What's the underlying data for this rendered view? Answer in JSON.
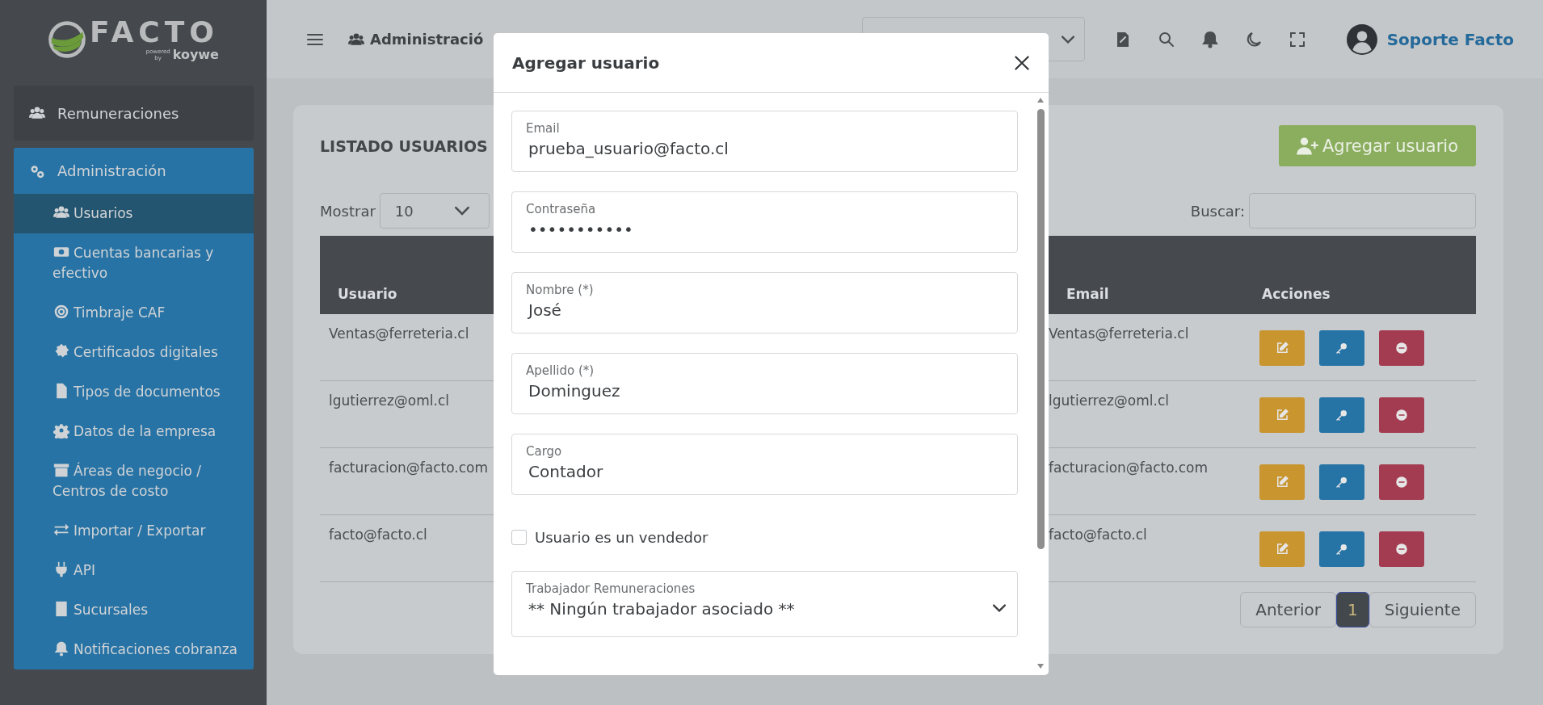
{
  "sidebar": {
    "logo": {
      "name": "FACTO",
      "tagline": "powered",
      "by": "by",
      "brand": "koywe"
    },
    "sections": [
      {
        "label": "Remuneraciones",
        "expanded": false
      },
      {
        "label": "Administración",
        "expanded": true,
        "children": [
          {
            "label": "Usuarios",
            "selected": true
          },
          {
            "label": "Cuentas bancarias y efectivo",
            "selected": false
          },
          {
            "label": "Timbraje CAF",
            "selected": false
          },
          {
            "label": "Certificados digitales",
            "selected": false
          },
          {
            "label": "Tipos de documentos",
            "selected": false
          },
          {
            "label": "Datos de la empresa",
            "selected": false
          },
          {
            "label": "Áreas de negocio / Centros de costo",
            "selected": false
          },
          {
            "label": "Importar / Exportar",
            "selected": false
          },
          {
            "label": "API",
            "selected": false
          },
          {
            "label": "Sucursales",
            "selected": false
          },
          {
            "label": "Notificaciones cobranza",
            "selected": false
          }
        ]
      }
    ]
  },
  "header": {
    "section": "Administració",
    "user": "Soporte Facto"
  },
  "page": {
    "title": "LISTADO USUARIOS",
    "add_button": "Agregar usuario",
    "length": {
      "label": "Mostrar",
      "value": "10"
    },
    "search": {
      "label": "Buscar:"
    },
    "table": {
      "columns": [
        {
          "label": "Usuario"
        },
        {
          "label": "Email"
        },
        {
          "label": "Acciones"
        }
      ],
      "rows": [
        {
          "user": "Ventas@ferreteria.cl",
          "email": "Ventas@ferreteria.cl"
        },
        {
          "user": "lgutierrez@oml.cl",
          "email": "lgutierrez@oml.cl"
        },
        {
          "user": "facturacion@facto.com",
          "email": "facturacion@facto.com"
        },
        {
          "user": "facto@facto.cl",
          "email": "facto@facto.cl"
        }
      ]
    },
    "pagination": {
      "previous": "Anterior",
      "pages": [
        {
          "label": "1",
          "selected": true
        }
      ],
      "next": "Siguiente"
    }
  },
  "modal": {
    "title": "Agregar usuario",
    "fields": [
      {
        "kind": "text",
        "label": "Email",
        "value": "prueba_usuario@facto.cl"
      },
      {
        "kind": "text",
        "label": "Contraseña",
        "value": "•••••••••••"
      },
      {
        "kind": "text",
        "label": "Nombre (*)",
        "value": "José"
      },
      {
        "kind": "text",
        "label": "Apellido (*)",
        "value": "Dominguez"
      },
      {
        "kind": "text",
        "label": "Cargo",
        "value": "Contador"
      },
      {
        "kind": "checkbox",
        "label": "Usuario es un vendedor",
        "checked": false
      },
      {
        "kind": "select",
        "label": "Trabajador Remuneraciones",
        "value": "** Ningún trabajador asociado **"
      }
    ]
  }
}
